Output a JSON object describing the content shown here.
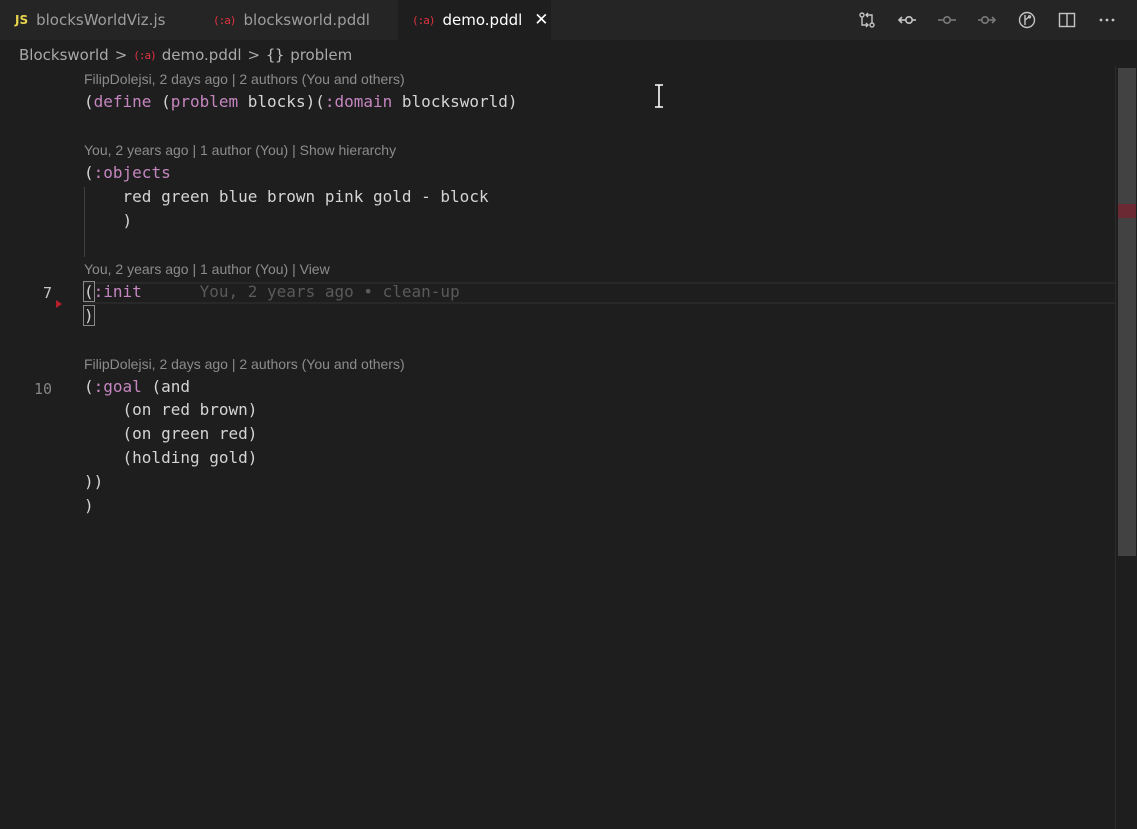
{
  "tabs": [
    {
      "badge": "JS",
      "label": "blocksWorldViz.js",
      "active": false
    },
    {
      "badge": "(:a)",
      "label": "blocksworld.pddl",
      "active": false
    },
    {
      "badge": "(:a)",
      "label": "demo.pddl",
      "active": true,
      "close": "✕"
    }
  ],
  "toolbar_icons": [
    "compare-changes-icon",
    "git-commit-icon",
    "previous-change-icon",
    "next-change-icon",
    "timeline-icon",
    "split-editor-icon",
    "more-actions-icon"
  ],
  "breadcrumb": {
    "folder": "Blocksworld",
    "file_badge": "(:a)",
    "file": "demo.pddl",
    "symbol_icon": "{}",
    "symbol": "problem",
    "separator": ">"
  },
  "lenses": [
    "FilipDolejsi, 2 days ago | 2 authors (You and others)",
    "You, 2 years ago | 1 author (You) | Show hierarchy",
    "You, 2 years ago | 1 author (You) | View",
    "FilipDolejsi, 2 days ago | 2 authors (You and others)"
  ],
  "line_numbers": {
    "current": "7",
    "other": "10"
  },
  "code": {
    "define_open": "(",
    "define_kw": "define",
    "problem_open": " (",
    "problem_kw": "problem",
    "problem_name": " blocks)(",
    "domain_kw": ":domain",
    "domain_name": " blocksworld)",
    "objects_open": "(",
    "objects_kw": ":objects",
    "objects_list": "    red green blue brown pink gold - block",
    "objects_close": "    )",
    "init_open": "(",
    "init_kw": ":init",
    "init_blame": "You, 2 years ago • clean-up",
    "init_close": ")",
    "goal_open": "(",
    "goal_kw": ":goal",
    "goal_and": " (and",
    "goal_1": "    (on red brown)",
    "goal_2": "    (on green red)",
    "goal_3": "    (holding gold)",
    "goal_close": "))",
    "define_close": ")"
  },
  "colors": {
    "background": "#1e1e1e",
    "keyword": "#c586c0",
    "js_badge": "#e8d44d",
    "pddl_badge": "#e0333f"
  }
}
